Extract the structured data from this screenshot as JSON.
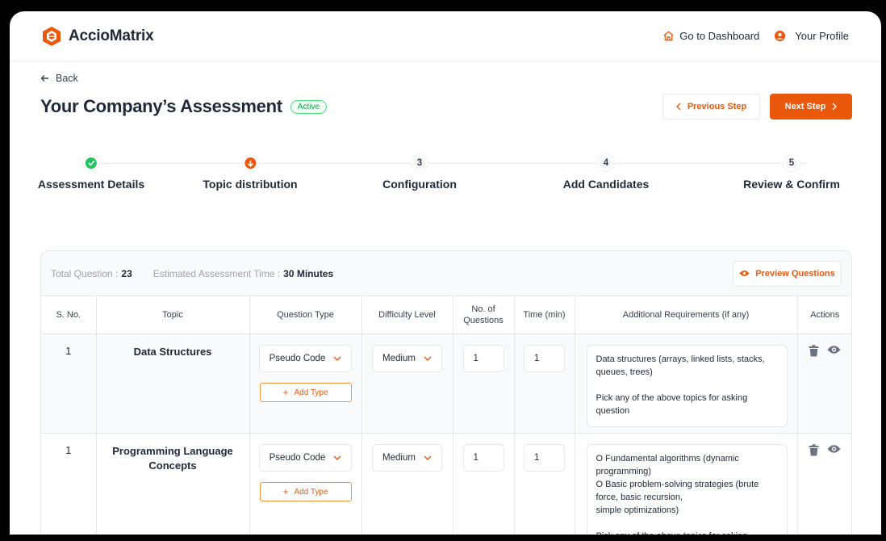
{
  "brand": {
    "name": "AccioMatrix",
    "accent": "#EA580C"
  },
  "topbar": {
    "dashboard_label": "Go to Dashboard",
    "profile_label": "Your Profile"
  },
  "nav": {
    "back_label": "Back"
  },
  "page": {
    "title": "Your Company’s Assessment",
    "status": "Active",
    "prev_label": "Previous Step",
    "next_label": "Next Step"
  },
  "steps": [
    {
      "number": "",
      "label": "Assessment Details",
      "state": "done"
    },
    {
      "number": "",
      "label": "Topic distribution",
      "state": "current"
    },
    {
      "number": "3",
      "label": "Configuration",
      "state": "pending"
    },
    {
      "number": "4",
      "label": "Add Candidates",
      "state": "pending"
    },
    {
      "number": "5",
      "label": "Review & Confirm",
      "state": "pending"
    }
  ],
  "summary": {
    "total_label": "Total Question :",
    "total_value": "23",
    "time_label": "Estimated Assessment Time :",
    "time_value": "30 Minutes",
    "preview_label": "Preview Questions"
  },
  "table": {
    "headers": [
      "S. No.",
      "Topic",
      "Question Type",
      "Difficulty Level",
      "No. of Questions",
      "Time (min)",
      "Additional Requirements (if any)",
      "Actions"
    ],
    "add_type_label": "Add Type",
    "rows": [
      {
        "sno": "1",
        "topic": "Data Structures",
        "question_type": "Pseudo Code",
        "difficulty": "Medium",
        "questions": "1",
        "time": "1",
        "requirements": "Data structures (arrays, linked lists, stacks, queues, trees)\n\nPick any of the above topics for asking question"
      },
      {
        "sno": "1",
        "topic": "Programming Language Concepts",
        "question_type": "Pseudo Code",
        "difficulty": "Medium",
        "questions": "1",
        "time": "1",
        "requirements": "O Fundamental algorithms (dynamic programming)\nO Basic problem-solving strategies (brute force, basic recursion,\nsimple optimizations)\n\nPick any of the above topics for asking question"
      }
    ]
  }
}
